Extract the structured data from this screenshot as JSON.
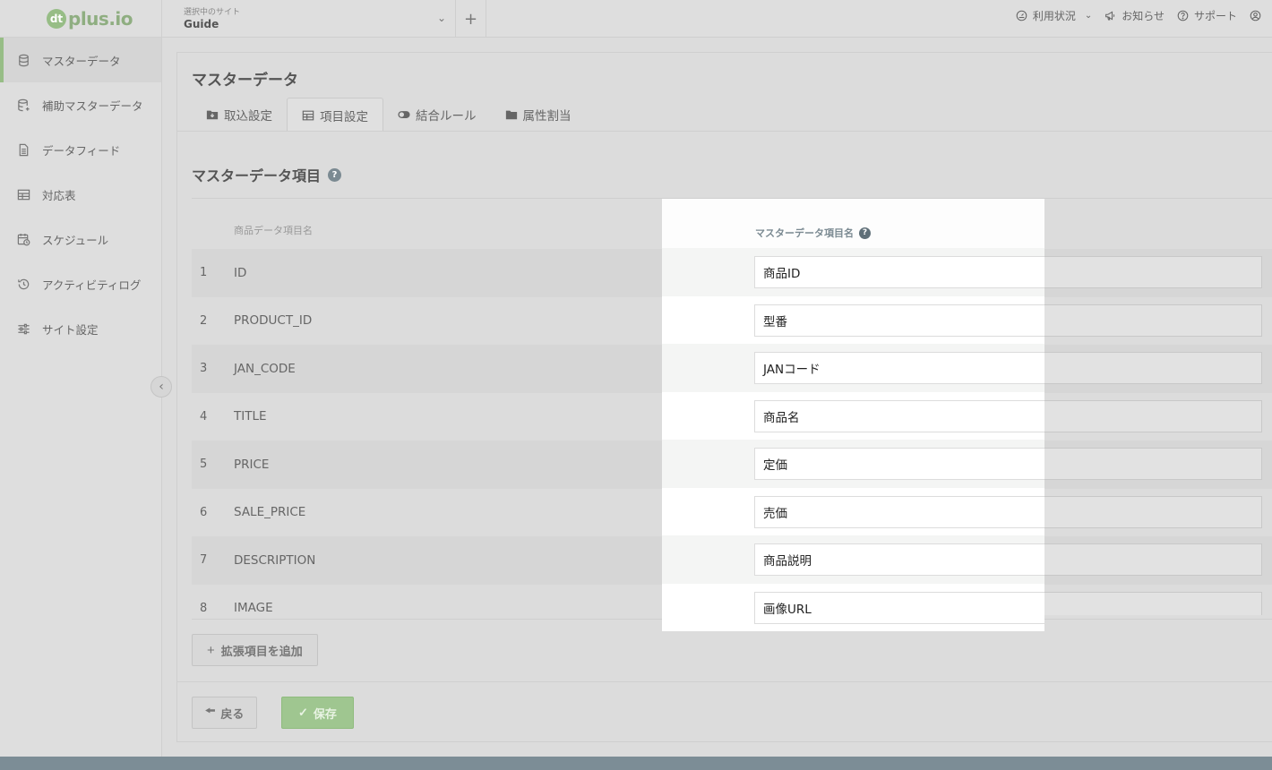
{
  "logo": {
    "mark": "dt",
    "text": "plus.io"
  },
  "sidebar": {
    "items": [
      {
        "label": "マスターデータ",
        "icon": "database-icon",
        "active": true
      },
      {
        "label": "補助マスターデータ",
        "icon": "database-plus-icon",
        "active": false
      },
      {
        "label": "データフィード",
        "icon": "document-icon",
        "active": false
      },
      {
        "label": "対応表",
        "icon": "table-icon",
        "active": false
      },
      {
        "label": "スケジュール",
        "icon": "calendar-clock-icon",
        "active": false
      },
      {
        "label": "アクティビティログ",
        "icon": "history-icon",
        "active": false
      },
      {
        "label": "サイト設定",
        "icon": "sliders-icon",
        "active": false
      }
    ]
  },
  "topbar": {
    "site_label": "選択中のサイト",
    "site_name": "Guide",
    "usage": "利用状況",
    "news": "お知らせ",
    "support": "サポート"
  },
  "main": {
    "title": "マスターデータ",
    "tabs": [
      {
        "label": "取込設定",
        "icon": "import-icon"
      },
      {
        "label": "項目設定",
        "icon": "grid-icon"
      },
      {
        "label": "結合ルール",
        "icon": "toggle-icon"
      },
      {
        "label": "属性割当",
        "icon": "folder-icon"
      }
    ],
    "section_title": "マスターデータ項目",
    "col_source": "商品データ項目名",
    "col_master": "マスターデータ項目名",
    "rows": [
      {
        "num": "1",
        "source": "ID",
        "master": "商品ID"
      },
      {
        "num": "2",
        "source": "PRODUCT_ID",
        "master": "型番"
      },
      {
        "num": "3",
        "source": "JAN_CODE",
        "master": "JANコード"
      },
      {
        "num": "4",
        "source": "TITLE",
        "master": "商品名"
      },
      {
        "num": "5",
        "source": "PRICE",
        "master": "定価"
      },
      {
        "num": "6",
        "source": "SALE_PRICE",
        "master": "売価"
      },
      {
        "num": "7",
        "source": "DESCRIPTION",
        "master": "商品説明"
      },
      {
        "num": "8",
        "source": "IMAGE",
        "master": "画像URL"
      }
    ],
    "add_field_label": "拡張項目を追加",
    "back_label": "戻る",
    "save_label": "保存"
  },
  "colors": {
    "accent": "#97bd86",
    "header_text": "#7b8a92"
  }
}
